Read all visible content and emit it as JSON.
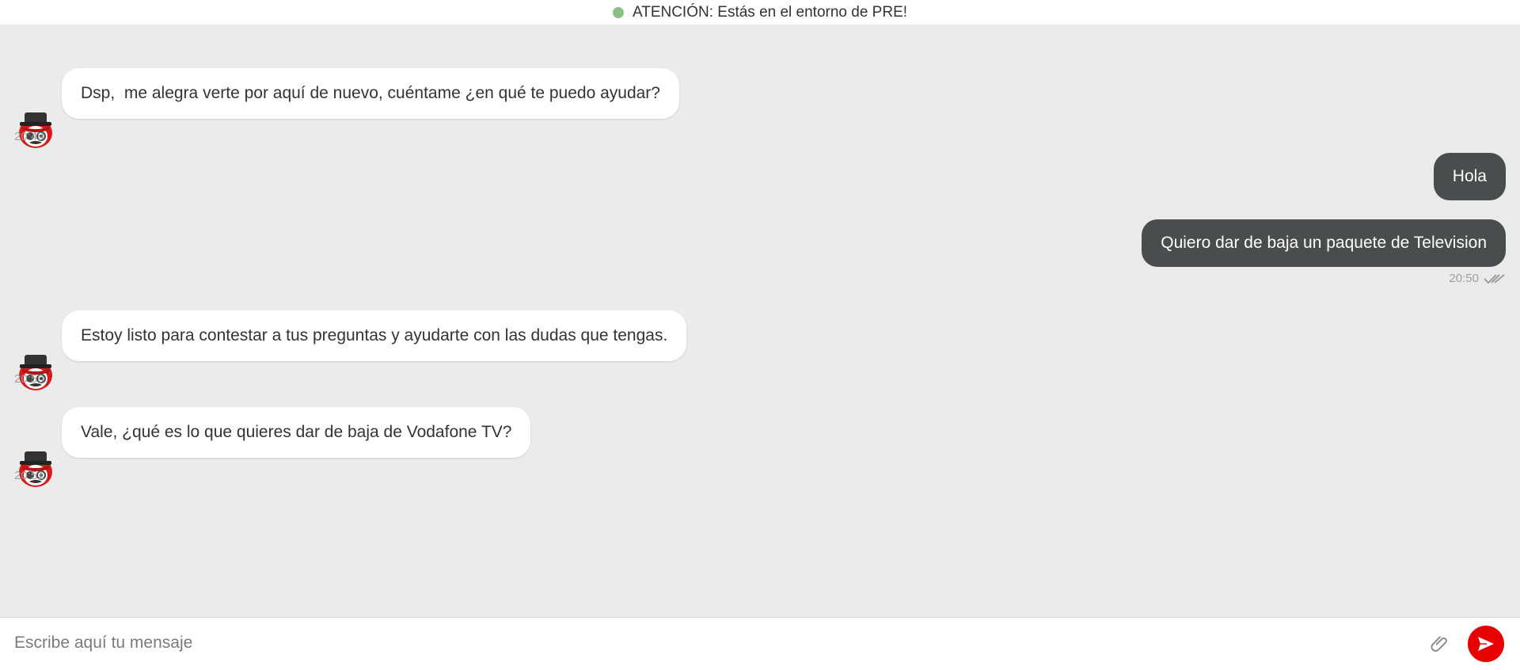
{
  "banner": {
    "text": "ATENCIÓN: Estás en el entorno de PRE!",
    "status_color": "#8cbf86"
  },
  "messages": [
    {
      "from": "bot",
      "text": "Dsp,  me alegra verte por aquí de nuevo, cuéntame ¿en qué te puedo ayudar?",
      "time": "20:49"
    },
    {
      "from": "user",
      "text": "Hola"
    },
    {
      "from": "user",
      "text": "Quiero dar de baja un paquete de Television",
      "time": "20:50",
      "status": "read"
    },
    {
      "from": "bot",
      "text": "Estoy listo para contestar a tus preguntas y ayudarte con las dudas que tengas.",
      "time": "20:50"
    },
    {
      "from": "bot",
      "text": "Vale, ¿qué es lo que quieres dar de baja de Vodafone TV?",
      "time": "20:51"
    }
  ],
  "composer": {
    "placeholder": "Escribe aquí tu mensaje",
    "value": "",
    "attach_icon": "paperclip-icon",
    "send_icon": "send-icon"
  },
  "colors": {
    "accent": "#e60000",
    "user_bubble": "#4a4d4e",
    "bot_bubble": "#ffffff",
    "background": "#ebebeb"
  }
}
